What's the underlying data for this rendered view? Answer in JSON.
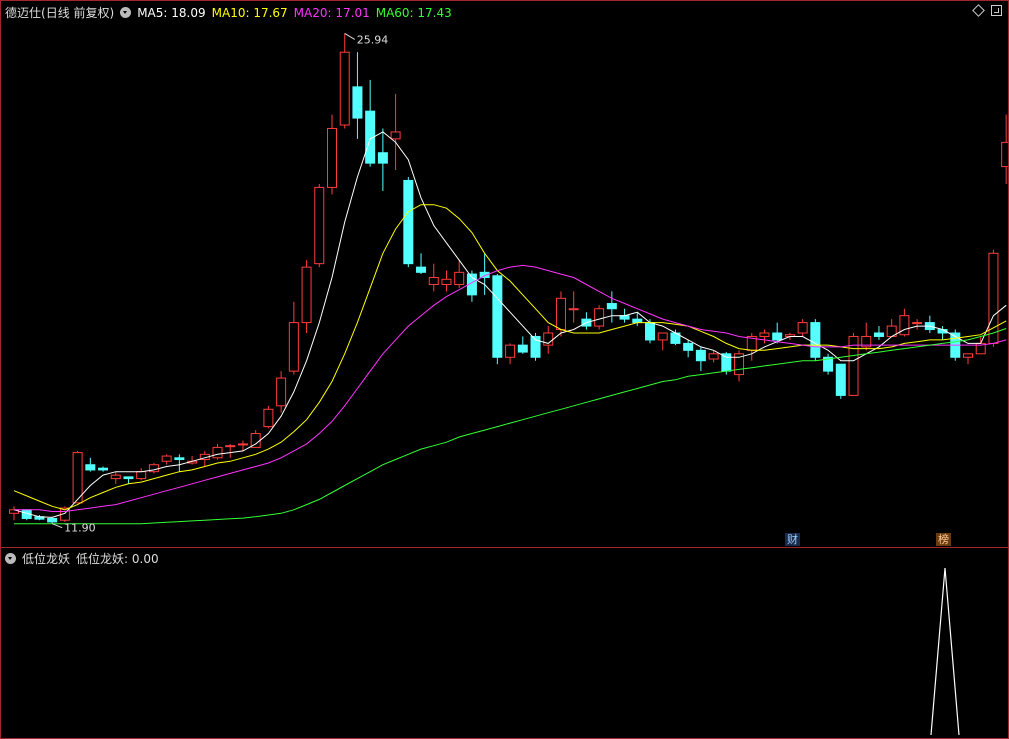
{
  "main": {
    "stock_name": "德迈仕",
    "period": "(日线 前复权)",
    "ma": [
      {
        "label": "MA5: 18.09",
        "color": "#ffffff"
      },
      {
        "label": "MA10: 17.67",
        "color": "#ffff00"
      },
      {
        "label": "MA20: 17.01",
        "color": "#ff33ff"
      },
      {
        "label": "MA60: 17.43",
        "color": "#33ff33"
      }
    ],
    "high_label": "25.94",
    "low_label": "11.90",
    "tag_cai": "财",
    "tag_bang": "榜"
  },
  "indicator": {
    "name": "低位龙妖",
    "value_label": "低位龙妖: 0.00"
  },
  "colors": {
    "up": "#ff3c3c",
    "down": "#54ffff",
    "border": "#a0282d",
    "bg": "#000000"
  },
  "chart_data": {
    "type": "candlestick",
    "ylim": [
      11.3,
      26.3
    ],
    "candles": [
      [
        12.1,
        12.3,
        11.9,
        12.2
      ],
      [
        12.2,
        12.2,
        11.9,
        11.95
      ],
      [
        12.0,
        12.05,
        11.9,
        11.93
      ],
      [
        11.95,
        12.0,
        11.8,
        11.85
      ],
      [
        11.9,
        12.3,
        11.85,
        12.25
      ],
      [
        12.4,
        13.9,
        12.4,
        13.85
      ],
      [
        13.5,
        13.7,
        13.3,
        13.35
      ],
      [
        13.4,
        13.45,
        13.3,
        13.35
      ],
      [
        13.1,
        13.3,
        12.95,
        13.2
      ],
      [
        13.15,
        13.15,
        12.95,
        13.1
      ],
      [
        13.1,
        13.4,
        13.05,
        13.3
      ],
      [
        13.3,
        13.55,
        13.25,
        13.5
      ],
      [
        13.6,
        13.8,
        13.5,
        13.75
      ],
      [
        13.7,
        13.8,
        13.3,
        13.65
      ],
      [
        13.55,
        13.75,
        13.5,
        13.6
      ],
      [
        13.65,
        13.9,
        13.45,
        13.8
      ],
      [
        13.7,
        14.1,
        13.65,
        14.0
      ],
      [
        14.05,
        14.1,
        13.7,
        14.05
      ],
      [
        14.1,
        14.2,
        13.9,
        14.1
      ],
      [
        14.0,
        14.5,
        14.0,
        14.4
      ],
      [
        14.6,
        15.2,
        14.55,
        15.1
      ],
      [
        15.2,
        16.2,
        15.0,
        16.0
      ],
      [
        16.2,
        18.2,
        16.1,
        17.6
      ],
      [
        17.6,
        19.4,
        17.3,
        19.2
      ],
      [
        19.3,
        21.6,
        19.2,
        21.5
      ],
      [
        21.5,
        23.6,
        21.3,
        23.2
      ],
      [
        23.3,
        25.94,
        23.2,
        25.4
      ],
      [
        24.4,
        25.4,
        22.9,
        23.5
      ],
      [
        23.7,
        24.6,
        22.1,
        22.2
      ],
      [
        22.5,
        23.2,
        21.4,
        22.2
      ],
      [
        22.9,
        24.2,
        22.0,
        23.1
      ],
      [
        21.7,
        21.8,
        19.2,
        19.3
      ],
      [
        19.2,
        19.6,
        19.0,
        19.05
      ],
      [
        18.7,
        19.3,
        18.5,
        18.9
      ],
      [
        18.7,
        19.1,
        18.5,
        18.85
      ],
      [
        18.7,
        19.4,
        18.6,
        19.05
      ],
      [
        19.0,
        19.1,
        18.2,
        18.4
      ],
      [
        19.05,
        19.6,
        18.4,
        18.9
      ],
      [
        18.95,
        19.0,
        16.4,
        16.6
      ],
      [
        16.6,
        17.0,
        16.4,
        16.95
      ],
      [
        16.95,
        17.2,
        16.7,
        16.75
      ],
      [
        17.2,
        17.3,
        16.5,
        16.6
      ],
      [
        16.95,
        17.5,
        16.7,
        17.3
      ],
      [
        17.4,
        18.5,
        17.2,
        18.3
      ],
      [
        18.0,
        18.5,
        17.6,
        18.0
      ],
      [
        17.7,
        17.9,
        17.4,
        17.5
      ],
      [
        17.5,
        18.1,
        17.4,
        18.0
      ],
      [
        18.15,
        18.5,
        17.6,
        18.0
      ],
      [
        17.8,
        18.0,
        17.6,
        17.7
      ],
      [
        17.7,
        17.9,
        17.5,
        17.6
      ],
      [
        17.6,
        17.7,
        17.0,
        17.1
      ],
      [
        17.1,
        17.3,
        16.8,
        17.3
      ],
      [
        17.3,
        17.4,
        16.95,
        17.0
      ],
      [
        17.0,
        17.1,
        16.6,
        16.8
      ],
      [
        16.8,
        16.9,
        16.2,
        16.5
      ],
      [
        16.55,
        16.8,
        16.45,
        16.7
      ],
      [
        16.7,
        16.75,
        16.1,
        16.2
      ],
      [
        16.1,
        16.8,
        15.9,
        16.7
      ],
      [
        16.8,
        17.3,
        16.5,
        17.2
      ],
      [
        17.2,
        17.4,
        17.0,
        17.3
      ],
      [
        17.3,
        17.6,
        17.0,
        17.1
      ],
      [
        17.2,
        17.3,
        17.1,
        17.25
      ],
      [
        17.3,
        17.7,
        17.2,
        17.6
      ],
      [
        17.6,
        17.7,
        16.5,
        16.6
      ],
      [
        16.6,
        16.7,
        16.1,
        16.2
      ],
      [
        16.4,
        16.4,
        15.4,
        15.5
      ],
      [
        15.5,
        17.3,
        15.5,
        17.2
      ],
      [
        16.9,
        17.6,
        16.8,
        17.2
      ],
      [
        17.3,
        17.5,
        17.1,
        17.2
      ],
      [
        17.2,
        17.7,
        17.2,
        17.5
      ],
      [
        17.25,
        18.0,
        17.2,
        17.8
      ],
      [
        17.6,
        17.7,
        17.4,
        17.6
      ],
      [
        17.6,
        17.8,
        17.3,
        17.4
      ],
      [
        17.4,
        17.5,
        17.1,
        17.3
      ],
      [
        17.3,
        17.4,
        16.5,
        16.6
      ],
      [
        16.6,
        16.7,
        16.4,
        16.7
      ],
      [
        16.7,
        17.2,
        16.7,
        17.0
      ],
      [
        17.0,
        19.7,
        16.9,
        19.6
      ],
      [
        22.1,
        23.6,
        21.6,
        22.8
      ]
    ],
    "ma5": [
      12.2,
      12.1,
      12.0,
      11.98,
      12.1,
      12.5,
      12.9,
      13.2,
      13.3,
      13.3,
      13.3,
      13.35,
      13.45,
      13.5,
      13.6,
      13.7,
      13.8,
      13.85,
      13.9,
      14.1,
      14.4,
      14.9,
      15.6,
      16.5,
      17.6,
      18.9,
      20.5,
      21.8,
      22.9,
      23.1,
      22.8,
      22.3,
      21.2,
      20.4,
      19.9,
      19.4,
      18.9,
      18.7,
      18.3,
      17.9,
      17.5,
      17.1,
      17.0,
      17.3,
      17.4,
      17.6,
      17.7,
      17.8,
      17.8,
      17.9,
      17.6,
      17.5,
      17.3,
      17.1,
      16.9,
      16.8,
      16.6,
      16.6,
      16.7,
      16.9,
      17.05,
      17.2,
      17.2,
      17.0,
      16.8,
      16.5,
      16.5,
      16.7,
      16.9,
      17.2,
      17.4,
      17.5,
      17.5,
      17.4,
      17.2,
      17.0,
      17.0,
      17.8,
      18.1
    ],
    "ma10": [
      12.75,
      12.6,
      12.45,
      12.3,
      12.2,
      12.35,
      12.55,
      12.7,
      12.85,
      12.95,
      13.0,
      13.1,
      13.2,
      13.3,
      13.35,
      13.45,
      13.55,
      13.6,
      13.7,
      13.8,
      13.95,
      14.15,
      14.45,
      14.8,
      15.3,
      15.9,
      16.7,
      17.6,
      18.6,
      19.6,
      20.3,
      20.8,
      21.0,
      21.0,
      20.9,
      20.6,
      20.2,
      19.6,
      19.1,
      18.8,
      18.4,
      18.0,
      17.6,
      17.4,
      17.3,
      17.3,
      17.3,
      17.4,
      17.5,
      17.6,
      17.6,
      17.6,
      17.55,
      17.5,
      17.35,
      17.2,
      17.0,
      16.85,
      16.8,
      16.8,
      16.85,
      16.9,
      16.95,
      16.95,
      16.95,
      16.9,
      16.85,
      16.85,
      16.85,
      16.9,
      17.0,
      17.05,
      17.1,
      17.1,
      17.15,
      17.2,
      17.25,
      17.45,
      17.65
    ],
    "ma20": [
      12.2,
      12.2,
      12.2,
      12.15,
      12.15,
      12.2,
      12.25,
      12.3,
      12.35,
      12.45,
      12.55,
      12.65,
      12.75,
      12.85,
      12.95,
      13.05,
      13.15,
      13.25,
      13.35,
      13.45,
      13.55,
      13.7,
      13.9,
      14.1,
      14.4,
      14.75,
      15.2,
      15.7,
      16.2,
      16.7,
      17.1,
      17.5,
      17.8,
      18.1,
      18.35,
      18.55,
      18.75,
      18.95,
      19.1,
      19.2,
      19.25,
      19.2,
      19.1,
      19.0,
      18.9,
      18.7,
      18.5,
      18.3,
      18.15,
      18.0,
      17.85,
      17.7,
      17.6,
      17.5,
      17.4,
      17.35,
      17.3,
      17.2,
      17.15,
      17.1,
      17.05,
      17.0,
      16.95,
      16.9,
      16.9,
      16.9,
      16.95,
      16.95,
      16.95,
      16.95,
      16.95,
      16.95,
      16.95,
      16.95,
      16.95,
      16.95,
      16.95,
      17.0,
      17.1
    ],
    "ma60": [
      11.8,
      11.8,
      11.8,
      11.8,
      11.8,
      11.8,
      11.8,
      11.8,
      11.8,
      11.8,
      11.8,
      11.82,
      11.84,
      11.86,
      11.88,
      11.9,
      11.92,
      11.94,
      11.96,
      12.0,
      12.05,
      12.1,
      12.2,
      12.35,
      12.5,
      12.7,
      12.9,
      13.1,
      13.3,
      13.5,
      13.65,
      13.8,
      13.95,
      14.05,
      14.15,
      14.3,
      14.4,
      14.5,
      14.6,
      14.7,
      14.8,
      14.9,
      15.0,
      15.1,
      15.2,
      15.3,
      15.4,
      15.5,
      15.6,
      15.7,
      15.8,
      15.9,
      15.95,
      16.05,
      16.1,
      16.15,
      16.2,
      16.25,
      16.3,
      16.35,
      16.4,
      16.45,
      16.5,
      16.5,
      16.55,
      16.6,
      16.65,
      16.7,
      16.75,
      16.8,
      16.85,
      16.9,
      16.95,
      17.0,
      17.05,
      17.1,
      17.2,
      17.3,
      17.43
    ]
  }
}
